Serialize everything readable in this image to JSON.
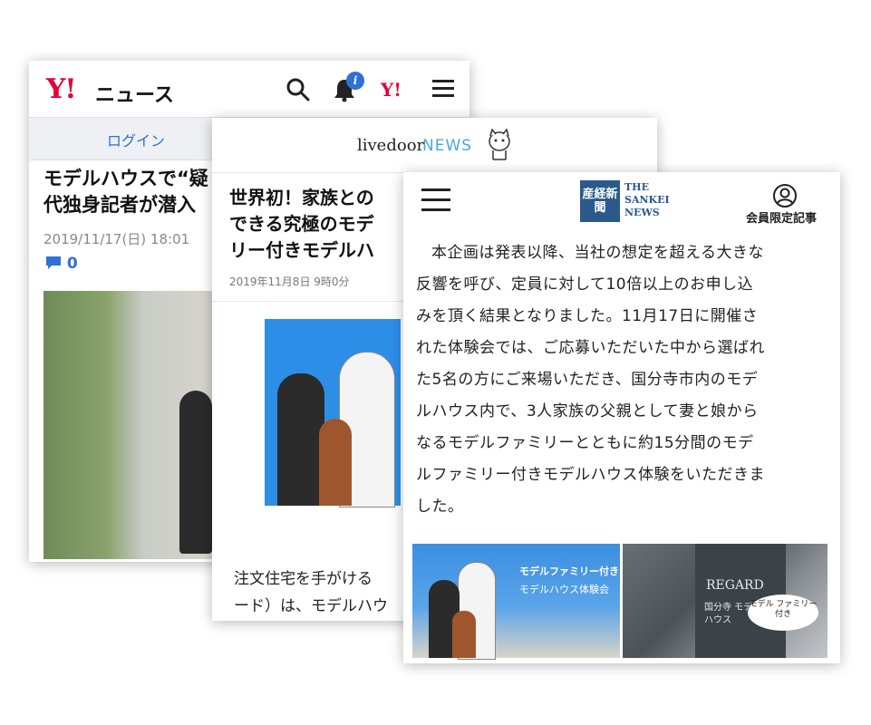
{
  "yahoo": {
    "logo": "Y!",
    "logo_news": "ニュース",
    "badge": "i",
    "small_logo": "Y!",
    "login_label": "ログイン",
    "headline_line1": "モデルハウスで“疑",
    "headline_line2": "代独身記者が潜入",
    "date": "2019/11/17(日) 18:01",
    "comment_count": "0",
    "icons": [
      "search-icon",
      "bell-icon",
      "yahoo-logo-icon",
      "hamburger-menu-icon",
      "comment-icon"
    ]
  },
  "livedoor": {
    "brand": "livedoor",
    "brand_news": "NEWS",
    "headline_line1": "世界初！家族との",
    "headline_line2": "できる究極のモデ",
    "headline_line3": "リー付きモデルハ",
    "date": "2019年11月8日 9時0分",
    "body_line1": "注文住宅を手がける",
    "body_line2": "ード）は、モデルハウ",
    "icons": [
      "dog-mascot-icon"
    ]
  },
  "sankei": {
    "seal_text": "産経新聞",
    "seal_en_1": "THE",
    "seal_en_2": "SANKEI",
    "seal_en_3": "NEWS",
    "member_label": "会員限定記事",
    "body_lines": [
      "本企画は発表以降、当社の想定を超える大きな",
      "反響を呼び、定員に対して10倍以上のお申し込",
      "みを頂く結果となりました。11月17日に開催さ",
      "れた体験会では、ご応募いただいた中から選ばれ",
      "た5名の方にご来場いただき、国分寺市内のモデ",
      "ルハウス内で、3人家族の父親として妻と娘から",
      "なるモデルファミリーとともに約15分間のモデ",
      "ルファミリー付きモデルハウス体験をいただきま",
      "した。"
    ],
    "image1_caption1": "モデルファミリー付き",
    "image1_caption2": "モデルハウス体験会",
    "image2_brand": "REGARD",
    "image2_sign": "国分寺 モデルハウス",
    "image2_bubble": "モデル ファミリー 付き",
    "icons": [
      "hamburger-menu-icon",
      "user-account-icon"
    ]
  },
  "colors": {
    "yahoo_red": "#e60033",
    "link_blue": "#2f6fd6",
    "livedoor_blue": "#47a7d6",
    "sankei_navy": "#2a5a8a"
  }
}
